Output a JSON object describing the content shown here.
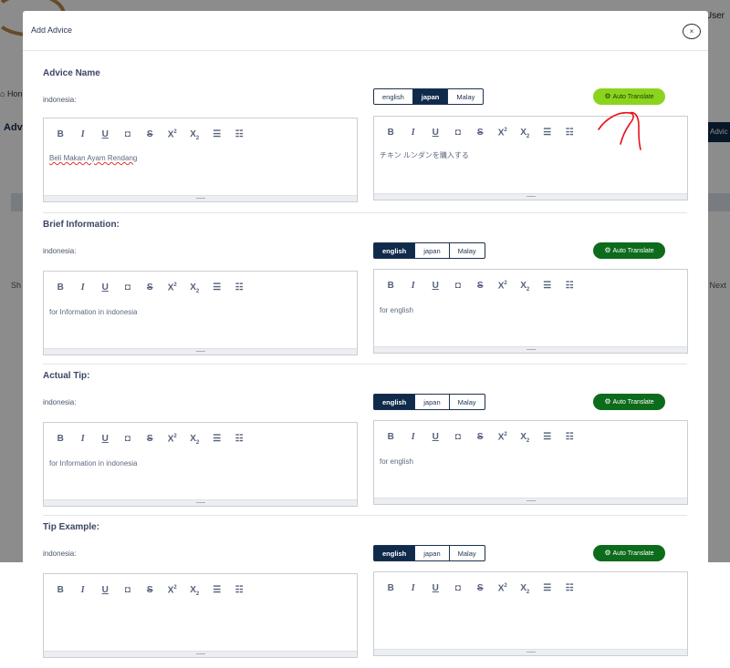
{
  "background": {
    "user_label": "User",
    "home_label": "Hon",
    "page_title": "Adv",
    "add_button": "Advic",
    "show_label": "Sh",
    "next_label": "Next"
  },
  "modal": {
    "title": "Add Advice",
    "close_label": "×",
    "auto_translate_label": "Auto Translate",
    "languages": [
      "english",
      "japan",
      "Malay"
    ],
    "toolbar": [
      "B",
      "I",
      "U",
      "eraser",
      "S",
      "X2",
      "X2",
      "bulleted-list",
      "numbered-list"
    ],
    "sections": [
      {
        "title": "Advice Name",
        "source_label": "indonesia:",
        "source_text": "Beli Makan Ayam Rendang",
        "active_language": "japan",
        "translated_text": "チキン ルンダンを購入する",
        "auto_translate_highlighted": true
      },
      {
        "title": "Brief Information:",
        "source_label": "indonesia:",
        "source_text": "for Information in indonesia",
        "active_language": "english",
        "translated_text": "for english",
        "auto_translate_highlighted": false
      },
      {
        "title": "Actual Tip:",
        "source_label": "indonesia:",
        "source_text": "for Information in indonesia",
        "active_language": "english",
        "translated_text": "for english",
        "auto_translate_highlighted": false
      },
      {
        "title": "Tip Example:",
        "source_label": "indonesia:",
        "source_text": "",
        "active_language": "english",
        "translated_text": "",
        "auto_translate_highlighted": false
      }
    ]
  },
  "colors": {
    "navy": "#0f2a4a",
    "auto_translate_green": "#0d6b1c",
    "auto_translate_highlight": "#8bd41e",
    "annotation_red": "#e8101a"
  }
}
